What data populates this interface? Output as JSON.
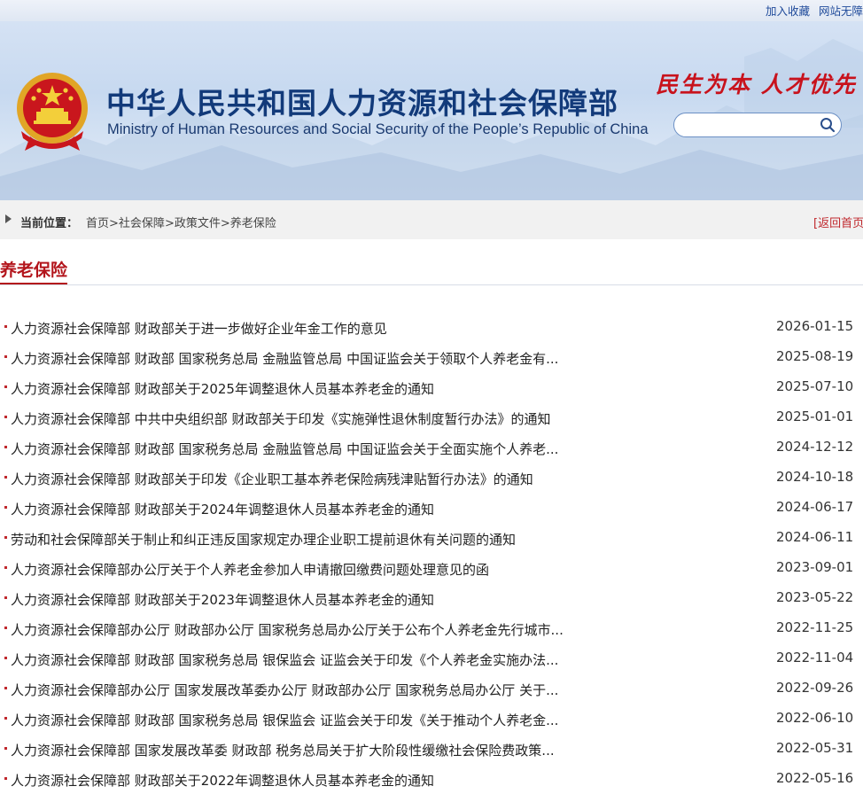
{
  "topbar": {
    "links": [
      "加入收藏",
      "网站无障"
    ]
  },
  "header": {
    "title_cn": "中华人民共和国人力资源和社会保障部",
    "title_en": "Ministry of Human Resources and Social Security of the People’s Republic of China",
    "slogan": "民生为本  人才优先",
    "search": {
      "placeholder": "",
      "value": ""
    }
  },
  "breadcrumb": {
    "label": "当前位置：",
    "items": [
      "首页",
      "社会保障",
      "政策文件",
      "养老保险"
    ],
    "sep": ">",
    "back": "[返回首页"
  },
  "section": {
    "title": "养老保险"
  },
  "articles": [
    {
      "title": "人力资源社会保障部 财政部关于进一步做好企业年金工作的意见",
      "date": "2026-01-15"
    },
    {
      "title": "人力资源社会保障部 财政部 国家税务总局 金融监管总局 中国证监会关于领取个人养老金有...",
      "date": "2025-08-19"
    },
    {
      "title": "人力资源社会保障部 财政部关于2025年调整退休人员基本养老金的通知",
      "date": "2025-07-10"
    },
    {
      "title": "人力资源社会保障部 中共中央组织部 财政部关于印发《实施弹性退休制度暂行办法》的通知",
      "date": "2025-01-01"
    },
    {
      "title": "人力资源社会保障部 财政部 国家税务总局 金融监管总局 中国证监会关于全面实施个人养老...",
      "date": "2024-12-12"
    },
    {
      "title": "人力资源社会保障部 财政部关于印发《企业职工基本养老保险病残津贴暂行办法》的通知",
      "date": "2024-10-18"
    },
    {
      "title": "人力资源社会保障部 财政部关于2024年调整退休人员基本养老金的通知",
      "date": "2024-06-17"
    },
    {
      "title": "劳动和社会保障部关于制止和纠正违反国家规定办理企业职工提前退休有关问题的通知",
      "date": "2024-06-11"
    },
    {
      "title": "人力资源社会保障部办公厅关于个人养老金参加人申请撤回缴费问题处理意见的函",
      "date": "2023-09-01"
    },
    {
      "title": "人力资源社会保障部 财政部关于2023年调整退休人员基本养老金的通知",
      "date": "2023-05-22"
    },
    {
      "title": "人力资源社会保障部办公厅 财政部办公厅 国家税务总局办公厅关于公布个人养老金先行城市...",
      "date": "2022-11-25"
    },
    {
      "title": "人力资源社会保障部 财政部 国家税务总局 银保监会 证监会关于印发《个人养老金实施办法...",
      "date": "2022-11-04"
    },
    {
      "title": "人力资源社会保障部办公厅 国家发展改革委办公厅 财政部办公厅 国家税务总局办公厅 关于...",
      "date": "2022-09-26"
    },
    {
      "title": "人力资源社会保障部 财政部 国家税务总局 银保监会 证监会关于印发《关于推动个人养老金...",
      "date": "2022-06-10"
    },
    {
      "title": "人力资源社会保障部 国家发展改革委 财政部 税务总局关于扩大阶段性缓缴社会保险费政策...",
      "date": "2022-05-31"
    },
    {
      "title": "人力资源社会保障部 财政部关于2022年调整退休人员基本养老金的通知",
      "date": "2022-05-16"
    }
  ]
}
